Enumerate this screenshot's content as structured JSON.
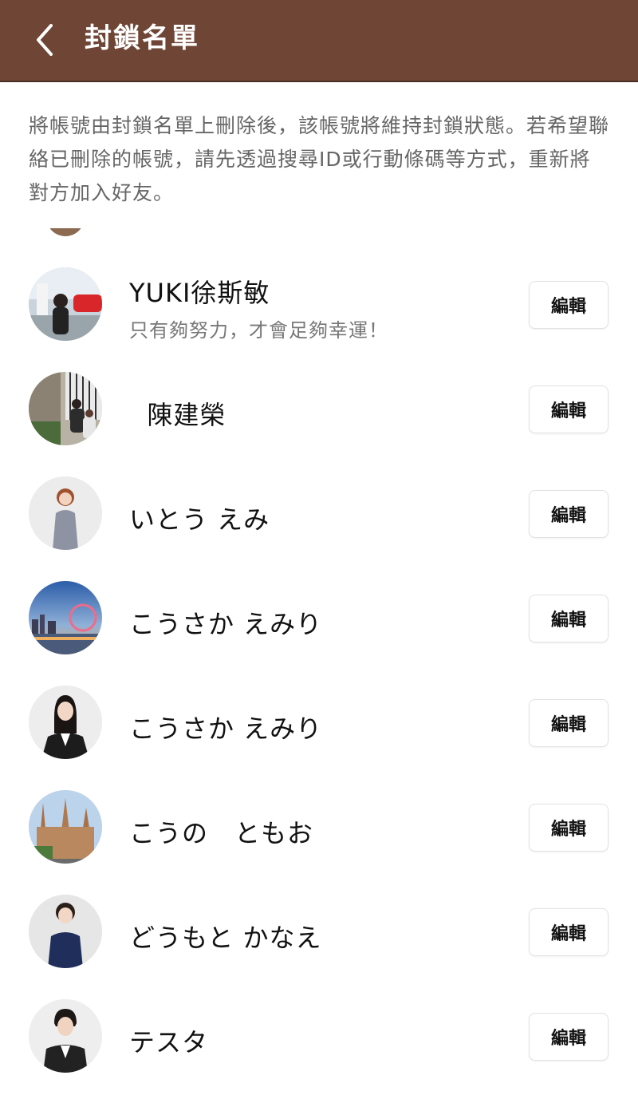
{
  "header": {
    "title": "封鎖名單",
    "back_icon": "chevron-left-icon",
    "background": "#6f4535"
  },
  "notice": "將帳號由封鎖名單上刪除後，該帳號將維持封鎖狀態。若希望聯絡已刪除的帳號，請先透過搜尋ID或行動條碼等方式，重新將對方加入好友。",
  "blocked_list": [
    {
      "name": "YUKI徐斯敏",
      "status": "只有夠努力，才會足夠幸運！",
      "edit_label": "編輯"
    },
    {
      "name": "  陳建榮",
      "status": "",
      "edit_label": "編輯"
    },
    {
      "name": "いとう えみ",
      "status": "",
      "edit_label": "編輯"
    },
    {
      "name": "こうさか えみり",
      "status": "",
      "edit_label": "編輯"
    },
    {
      "name": "こうさか えみり",
      "status": "",
      "edit_label": "編輯"
    },
    {
      "name": "こうの　ともお",
      "status": "",
      "edit_label": "編輯"
    },
    {
      "name": "どうもと かなえ",
      "status": "",
      "edit_label": "編輯"
    },
    {
      "name": "テスタ",
      "status": "",
      "edit_label": "編輯"
    }
  ]
}
